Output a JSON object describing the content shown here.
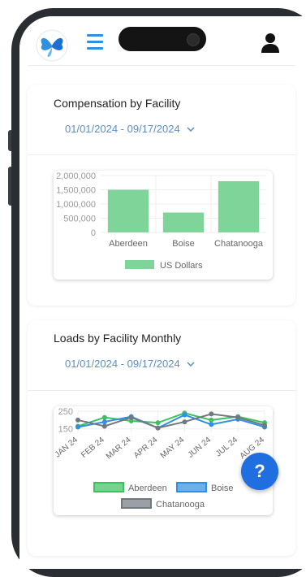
{
  "header": {
    "logo": "butterfly-logo",
    "menu_icon": "hamburger-icon",
    "profile_icon": "user-icon"
  },
  "compensation_card": {
    "title": "Compensation by Facility",
    "date_range": "01/01/2024 - 09/17/2024"
  },
  "loads_card": {
    "title": "Loads by Facility Monthly",
    "date_range": "01/01/2024 - 09/17/2024"
  },
  "help_button": {
    "label": "?"
  },
  "colors": {
    "accent": "#2f8fe0",
    "bar": "#7fd49a",
    "aberdeen": "#3cc060",
    "boise": "#2f8fe0",
    "chatanooga": "#707880"
  },
  "chart_data": [
    {
      "type": "bar",
      "categories": [
        "Aberdeen",
        "Boise",
        "Chatanooga"
      ],
      "series": [
        {
          "name": "US Dollars",
          "values": [
            1500000,
            700000,
            1800000
          ]
        }
      ],
      "ylim": [
        0,
        2000000
      ],
      "yticks": [
        "2,000,000",
        "1,500,000",
        "1,000,000",
        "500,000",
        "0"
      ],
      "legend": "bottom"
    },
    {
      "type": "line",
      "categories": [
        "JAN 24",
        "FEB 24",
        "MAR 24",
        "APR 24",
        "MAY 24",
        "JUN 24",
        "JUL 24",
        "AUG 24"
      ],
      "series": [
        {
          "name": "Aberdeen",
          "values": [
            165,
            215,
            195,
            185,
            240,
            200,
            220,
            185
          ]
        },
        {
          "name": "Boise",
          "values": [
            160,
            190,
            220,
            155,
            230,
            175,
            205,
            160
          ]
        },
        {
          "name": "Chatanooga",
          "values": [
            200,
            165,
            215,
            155,
            190,
            235,
            215,
            170
          ]
        }
      ],
      "ylim": [
        130,
        260
      ],
      "yticks": [
        "250",
        "150"
      ],
      "legend": "bottom"
    }
  ]
}
